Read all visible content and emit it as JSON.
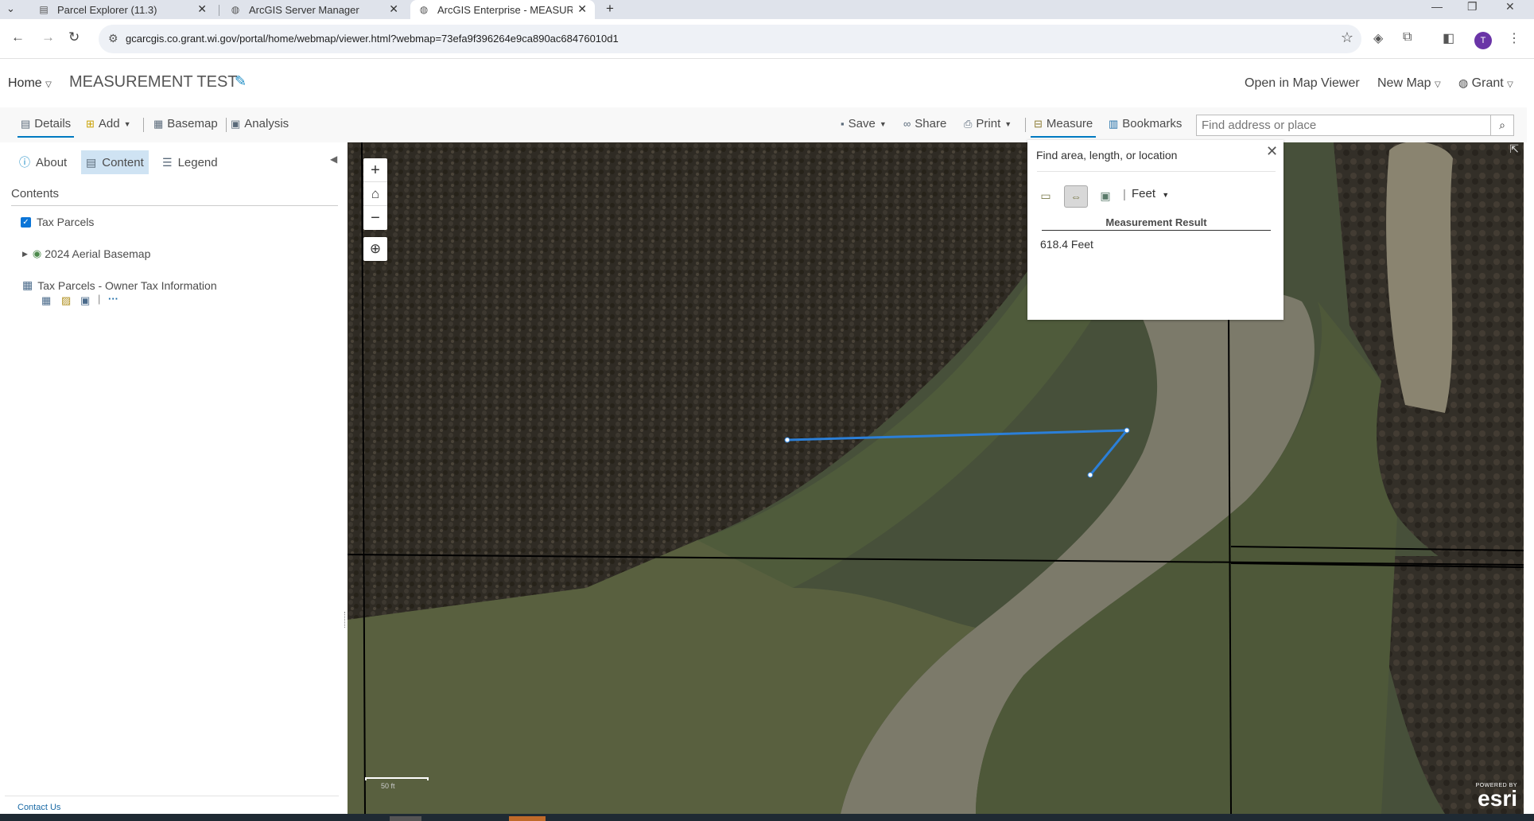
{
  "browser": {
    "tabs": [
      {
        "title": "Parcel Explorer (11.3)",
        "active": false
      },
      {
        "title": "ArcGIS Server Manager",
        "active": false
      },
      {
        "title": "ArcGIS Enterprise - MEASUREM",
        "active": true
      }
    ],
    "new_tab": "+",
    "url": "gcarcgis.co.grant.wi.gov/portal/home/webmap/viewer.html?webmap=73efa9f396264e9ca890ac68476010d1",
    "profile_initial": "T"
  },
  "portal": {
    "home_label": "Home",
    "map_title": "MEASUREMENT TEST",
    "open_in_map_viewer": "Open in Map Viewer",
    "new_map": "New Map",
    "user": "Grant"
  },
  "toolbar": {
    "details": "Details",
    "add": "Add",
    "basemap": "Basemap",
    "analysis": "Analysis",
    "save": "Save",
    "share": "Share",
    "print": "Print",
    "measure": "Measure",
    "bookmarks": "Bookmarks",
    "search_placeholder": "Find address or place"
  },
  "panel": {
    "tabs": {
      "about": "About",
      "content": "Content",
      "legend": "Legend"
    },
    "contents_heading": "Contents",
    "layers": [
      {
        "name": "Tax Parcels",
        "checked": true
      },
      {
        "name": "2024 Aerial Basemap"
      },
      {
        "name": "Tax Parcels - Owner Tax Information"
      }
    ],
    "more": "···",
    "contact_us": "Contact Us"
  },
  "measure": {
    "title": "Find area, length, or location",
    "unit": "Feet",
    "result_heading": "Measurement Result",
    "result": "618.4 Feet"
  },
  "map": {
    "attribution_top": "POWERED BY",
    "attribution_logo": "esri",
    "scale_label": "50 ft",
    "measure_line_color": "#2b7fd8"
  },
  "colors": {
    "accent": "#0079c1",
    "checkbox": "#0b75d7",
    "active_tab_bg": "#cfe3f3",
    "profile": "#6a34a7"
  }
}
